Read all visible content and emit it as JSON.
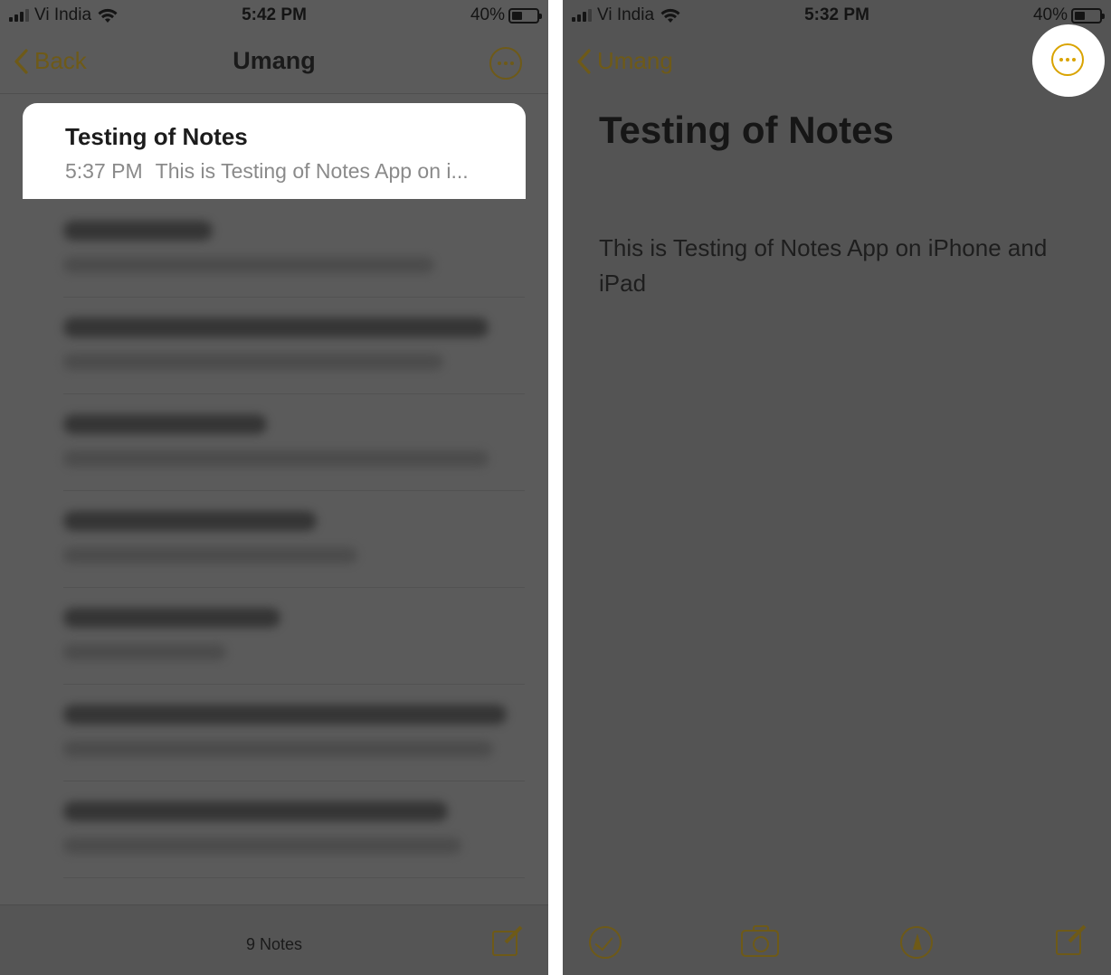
{
  "left_screen": {
    "status": {
      "carrier": "Vi India",
      "time": "5:42 PM",
      "battery": "40%"
    },
    "nav": {
      "back_label": "Back",
      "title": "Umang"
    },
    "highlighted_note": {
      "title": "Testing of Notes",
      "time": "5:37 PM",
      "preview": "This is Testing of Notes App on i..."
    },
    "toolbar": {
      "count": "9 Notes"
    }
  },
  "right_screen": {
    "status": {
      "carrier": "Vi India",
      "time": "5:32 PM",
      "battery": "40%"
    },
    "nav": {
      "back_label": "Umang"
    },
    "note": {
      "title": "Testing of Notes",
      "body": "This is Testing of Notes App on iPhone and iPad"
    }
  },
  "colors": {
    "accent": "#d9a300",
    "dim_accent": "#6e5a18"
  },
  "icons": [
    "signal-icon",
    "wifi-icon",
    "battery-icon",
    "chevron-left-icon",
    "more-icon",
    "compose-icon",
    "checklist-icon",
    "camera-icon",
    "markup-icon"
  ]
}
